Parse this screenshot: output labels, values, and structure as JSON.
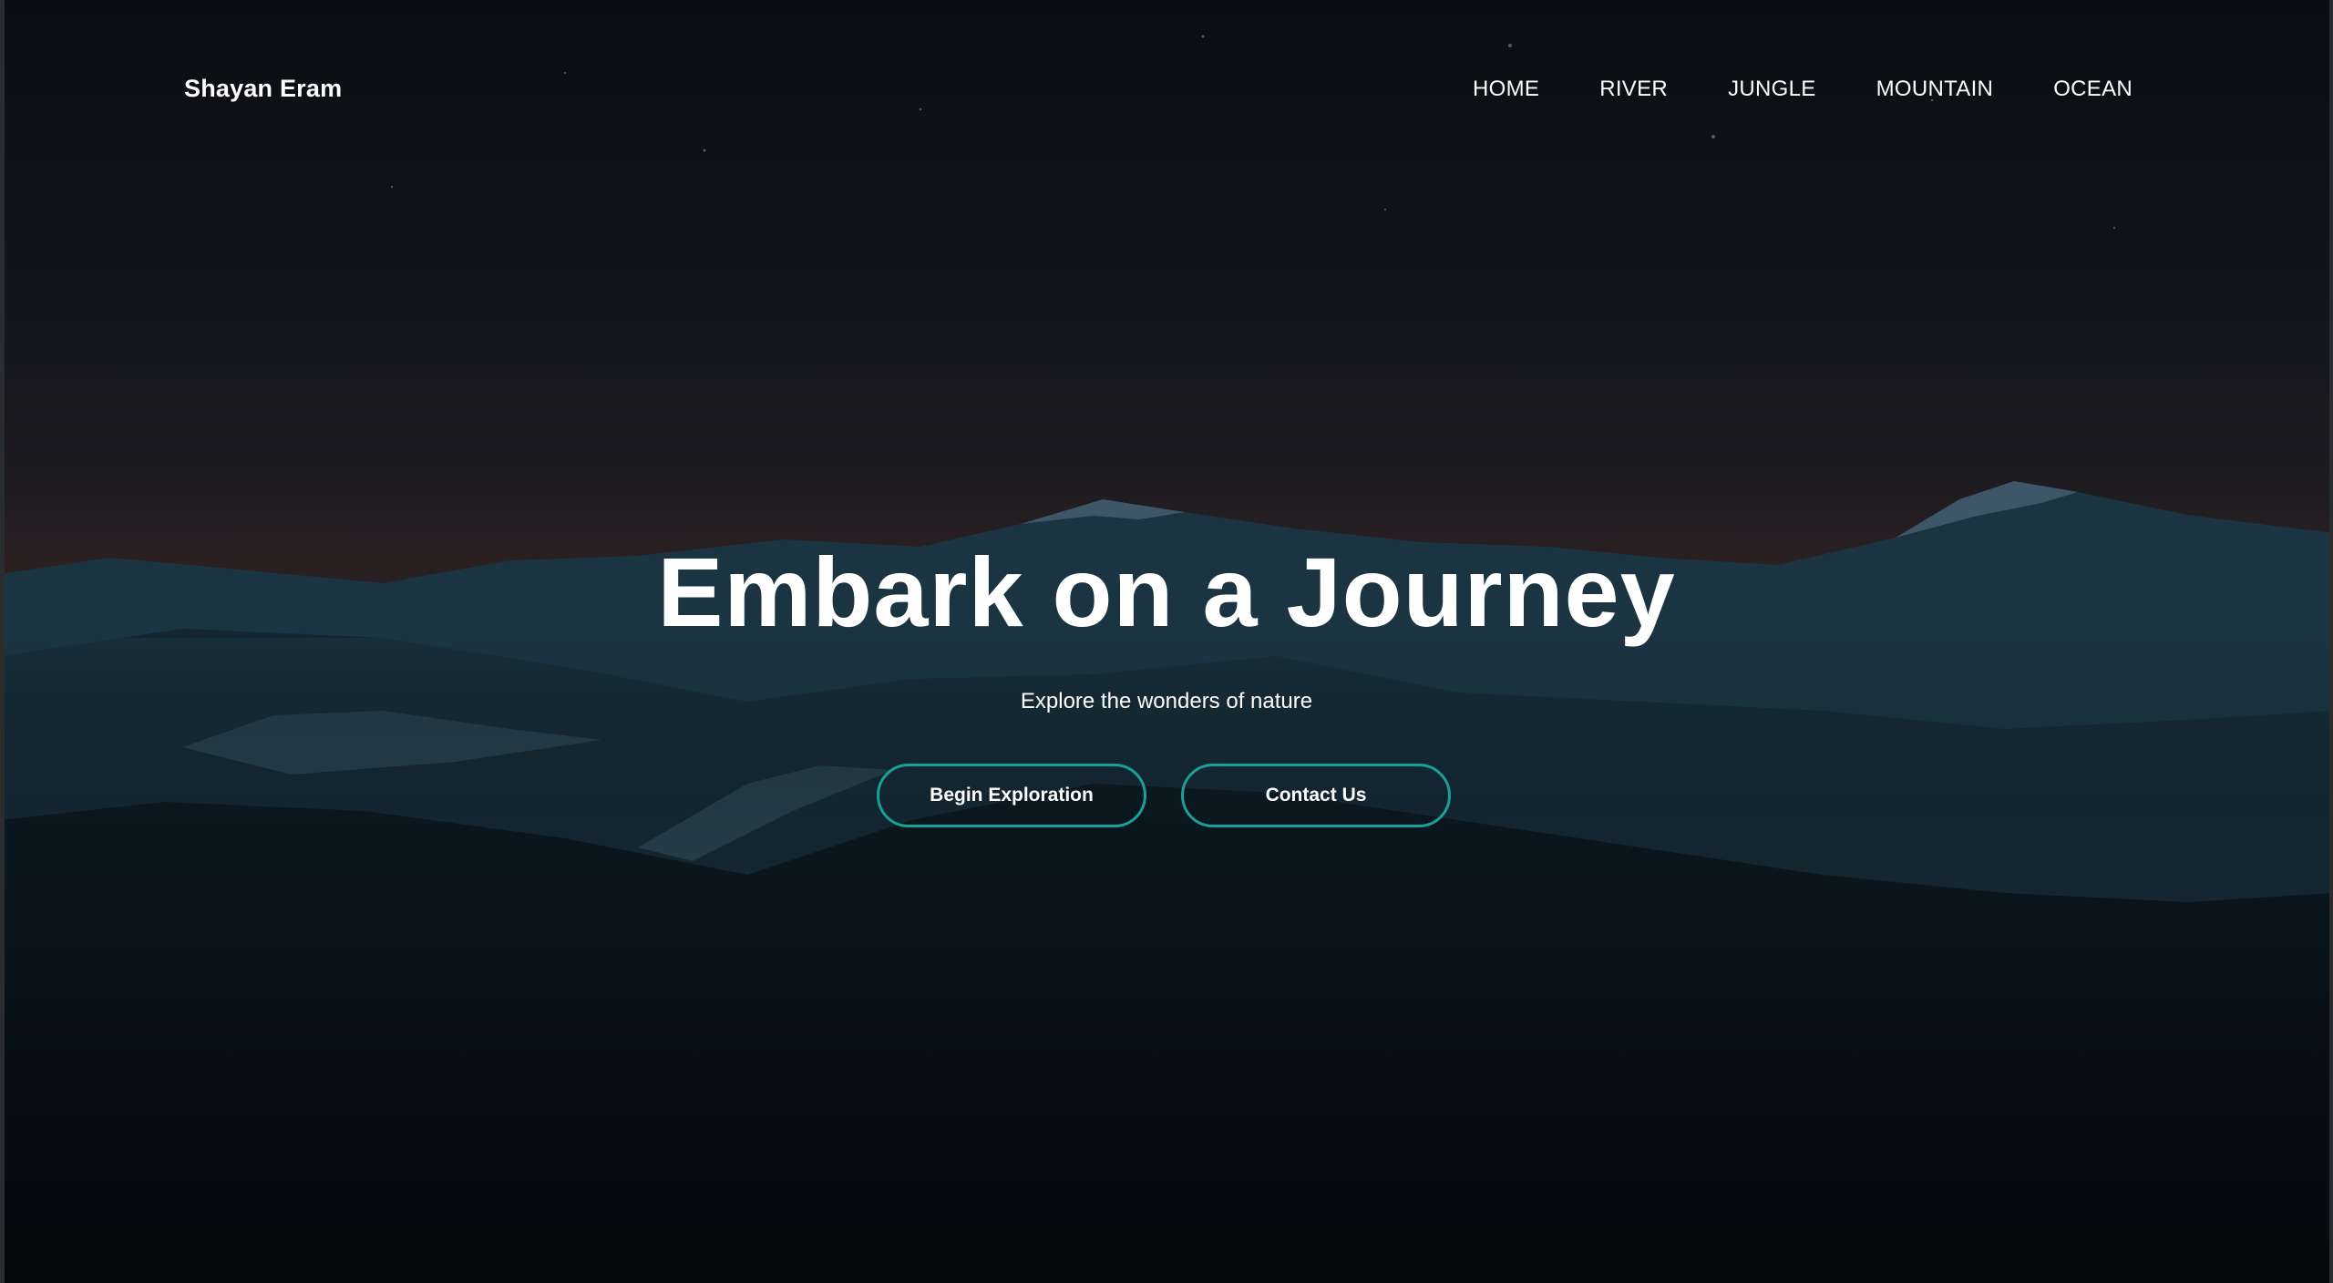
{
  "brand": {
    "name": "Shayan Eram"
  },
  "nav": {
    "items": [
      {
        "label": "HOME"
      },
      {
        "label": "RIVER"
      },
      {
        "label": "JUNGLE"
      },
      {
        "label": "MOUNTAIN"
      },
      {
        "label": "OCEAN"
      }
    ]
  },
  "hero": {
    "title": "Embark on a Journey",
    "subtitle": "Explore the wonders of nature",
    "primary_button": "Begin Exploration",
    "secondary_button": "Contact Us"
  },
  "colors": {
    "accent": "#1aa195",
    "text": "#ffffff",
    "sky_top": "#0b0d12",
    "horizon_glow": "#2b2022",
    "forest": "#050a0e"
  },
  "background": {
    "icon": "night-mountain-landscape-image"
  }
}
